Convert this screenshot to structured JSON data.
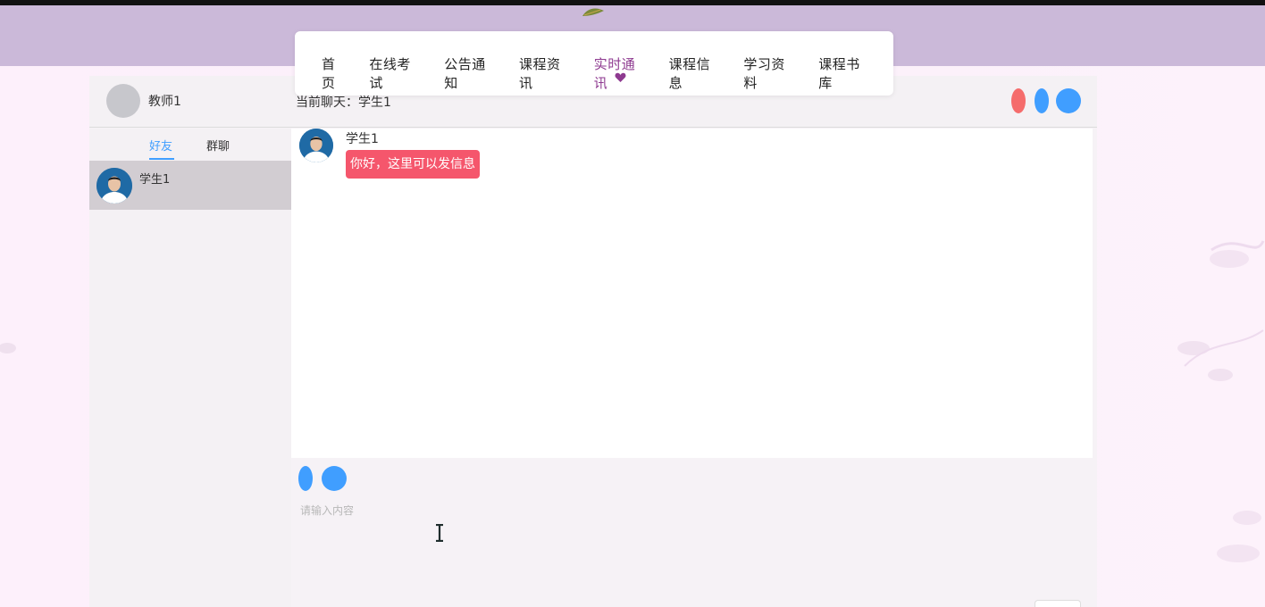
{
  "nav": {
    "items": [
      {
        "label": "首页"
      },
      {
        "label": "在线考试"
      },
      {
        "label": "公告通知"
      },
      {
        "label": "课程资讯"
      },
      {
        "label": "实时通讯",
        "active": true
      },
      {
        "label": "课程信息"
      },
      {
        "label": "学习资料"
      },
      {
        "label": "课程书库"
      }
    ],
    "active_color": "#8e3a90",
    "active_indicator_icon": "heart-icon"
  },
  "chat": {
    "me": {
      "name": "教师1"
    },
    "current_chat": "当前聊天：学生1",
    "window_buttons": [
      "red-dot",
      "blue-dot",
      "blue-dot"
    ],
    "tabs": [
      {
        "label": "好友",
        "active": true
      },
      {
        "label": "群聊"
      }
    ],
    "contacts": [
      {
        "name": "学生1",
        "selected": true
      }
    ],
    "messages": [
      {
        "sender": "学生1",
        "text": "你好，这里可以发信息",
        "bubble_color": "#f5566c"
      }
    ],
    "input": {
      "placeholder": "请输入内容",
      "value": ""
    }
  },
  "colors": {
    "header_band": "#cbb9d9",
    "accent_blue": "#409eff",
    "accent_red": "#f56c6c"
  }
}
